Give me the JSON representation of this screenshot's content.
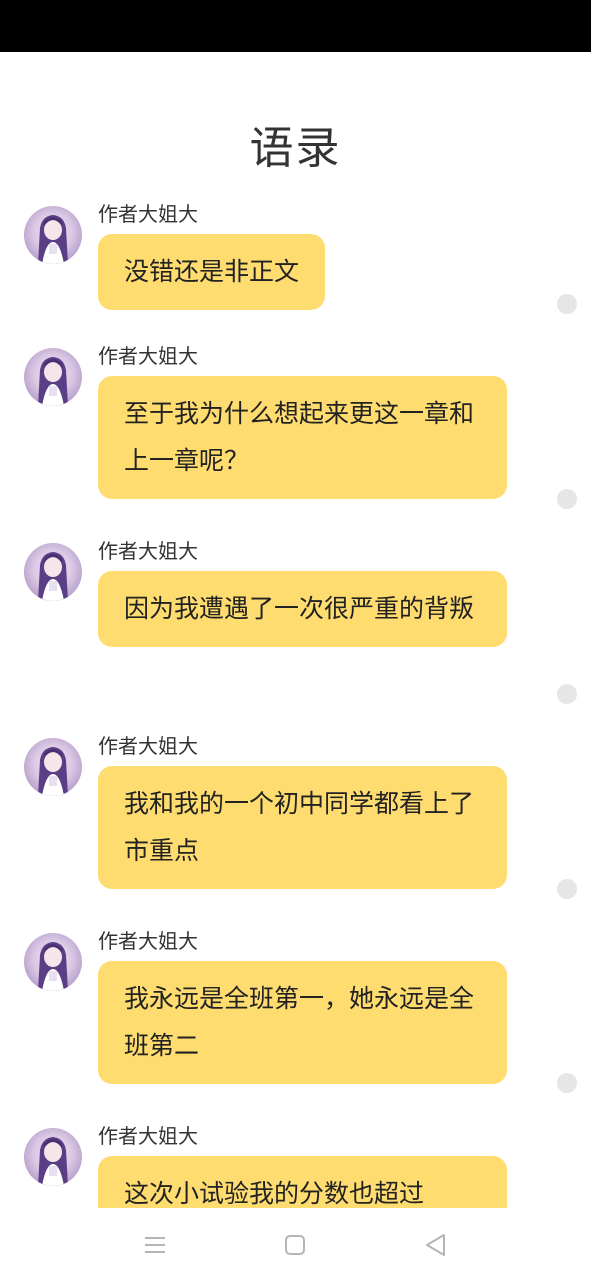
{
  "page": {
    "title": "语录"
  },
  "messages": [
    {
      "author": "作者大姐大",
      "text": "没错还是非正文"
    },
    {
      "author": "作者大姐大",
      "text": "至于我为什么想起来更这一章和上一章呢？"
    },
    {
      "author": "作者大姐大",
      "text": "因为我遭遇了一次很严重的背叛"
    },
    {
      "author": "作者大姐大",
      "text": "我和我的一个初中同学都看上了市重点"
    },
    {
      "author": "作者大姐大",
      "text": "我永远是全班第一，她永远是全班第二"
    },
    {
      "author": "作者大姐大",
      "text": "这次小试验我的分数也超过"
    }
  ],
  "colors": {
    "bubble": "#fedc6f",
    "status_bar": "#000000",
    "side_dot": "#e6e6e6"
  },
  "icons": {
    "avatar": "avatar-anime-girl-icon",
    "nav_menu": "menu-lines-icon",
    "nav_home": "square-home-icon",
    "nav_back": "triangle-back-icon"
  }
}
